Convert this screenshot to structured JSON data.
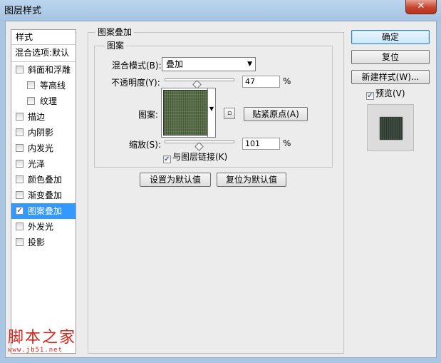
{
  "window": {
    "title": "图层样式",
    "close_glyph": "✕"
  },
  "style_list": {
    "header": "样式",
    "blend_options": "混合选项:默认",
    "items": [
      {
        "label": "斜面和浮雕",
        "checked": false,
        "sub": false,
        "selected": false
      },
      {
        "label": "等高线",
        "checked": false,
        "sub": true,
        "selected": false
      },
      {
        "label": "纹理",
        "checked": false,
        "sub": true,
        "selected": false
      },
      {
        "label": "描边",
        "checked": false,
        "sub": false,
        "selected": false
      },
      {
        "label": "内阴影",
        "checked": false,
        "sub": false,
        "selected": false
      },
      {
        "label": "内发光",
        "checked": false,
        "sub": false,
        "selected": false
      },
      {
        "label": "光泽",
        "checked": false,
        "sub": false,
        "selected": false
      },
      {
        "label": "颜色叠加",
        "checked": false,
        "sub": false,
        "selected": false
      },
      {
        "label": "渐变叠加",
        "checked": false,
        "sub": false,
        "selected": false
      },
      {
        "label": "图案叠加",
        "checked": true,
        "sub": false,
        "selected": true
      },
      {
        "label": "外发光",
        "checked": false,
        "sub": false,
        "selected": false
      },
      {
        "label": "投影",
        "checked": false,
        "sub": false,
        "selected": false
      }
    ]
  },
  "panel": {
    "group_title": "图案叠加",
    "subgroup_title": "图案",
    "blend_mode_label": "混合模式(B):",
    "blend_mode_value": "叠加",
    "opacity_label": "不透明度(Y):",
    "opacity_value": "47",
    "opacity_level": 0.47,
    "percent": "%",
    "pattern_label": "图案:",
    "snap_origin_button": "贴紧原点(A)",
    "scale_label": "缩放(S):",
    "scale_value": "101",
    "scale_level": 0.5,
    "link_layer_label": "与图层链接(K)",
    "link_layer_checked": true,
    "set_default_button": "设置为默认值",
    "reset_default_button": "复位为默认值"
  },
  "side_buttons": {
    "ok": "确定",
    "reset": "复位",
    "new_style": "新建样式(W)...",
    "preview_label": "预览(V)",
    "preview_checked": true
  },
  "watermark": {
    "text": "脚本之家",
    "url": "www.jb51.net"
  },
  "colors": {
    "selected": "#3399ff",
    "pattern": "#59704b",
    "watermark": "#d9261c"
  }
}
